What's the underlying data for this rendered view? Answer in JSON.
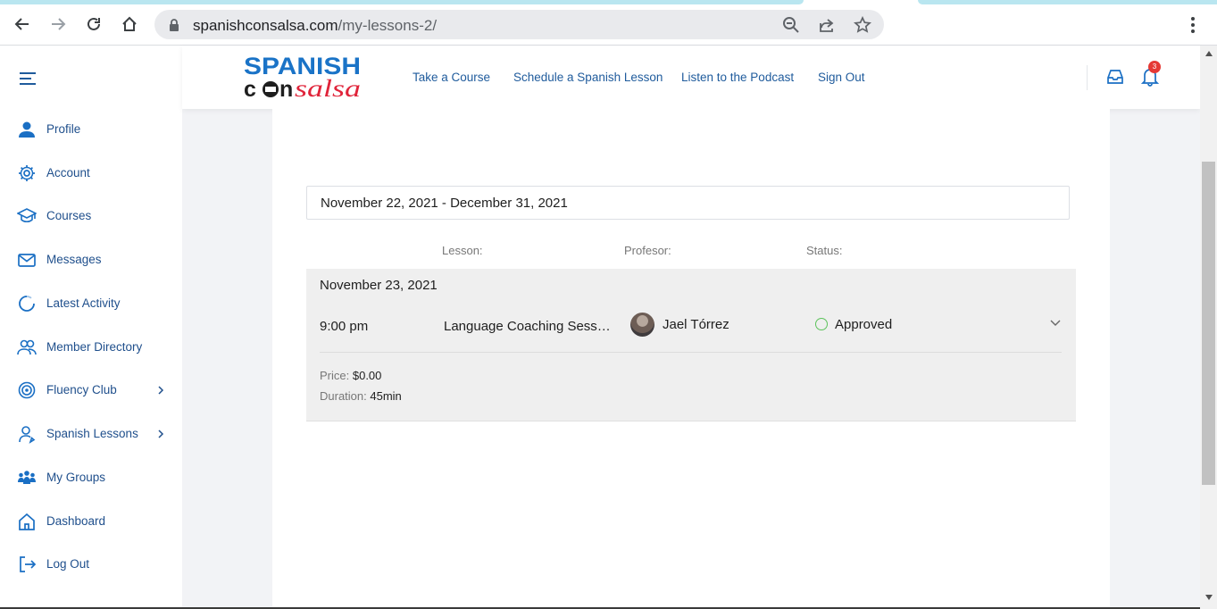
{
  "browser": {
    "url_host": "spanishconsalsa.com",
    "url_path": "/my-lessons-2/"
  },
  "site": {
    "logo_line1": "SPANISH",
    "logo_line2_a": "c",
    "logo_line2_b": "n",
    "logo_line2_c": "salsa",
    "nav": [
      "Take a Course",
      "Schedule a Spanish Lesson",
      "Listen to the Podcast",
      "Sign Out"
    ],
    "notification_count": "3"
  },
  "sidebar": {
    "items": [
      {
        "label": "Profile",
        "icon": "user-icon"
      },
      {
        "label": "Account",
        "icon": "gear-icon"
      },
      {
        "label": "Courses",
        "icon": "graduation-cap-icon"
      },
      {
        "label": "Messages",
        "icon": "envelope-icon"
      },
      {
        "label": "Latest Activity",
        "icon": "activity-icon"
      },
      {
        "label": "Member Directory",
        "icon": "users-icon"
      },
      {
        "label": "Fluency Club",
        "icon": "target-icon"
      },
      {
        "label": "Spanish Lessons",
        "icon": "person-outline-icon"
      },
      {
        "label": "My Groups",
        "icon": "groups-icon"
      },
      {
        "label": "Dashboard",
        "icon": "home-icon"
      },
      {
        "label": "Log Out",
        "icon": "logout-icon"
      }
    ]
  },
  "lessons": {
    "date_range": "November 22, 2021 - December 31, 2021",
    "col_lesson": "Lesson:",
    "col_profesor": "Profesor:",
    "col_status": "Status:",
    "entry": {
      "date": "November 23, 2021",
      "time": "9:00 pm",
      "lesson": "Language Coaching Session",
      "profesor": "Jael Tórrez",
      "status": "Approved",
      "price_label": "Price:",
      "price_value": "$0.00",
      "duration_label": "Duration:",
      "duration_value": "45min"
    }
  },
  "colors": {
    "accent": "#1f5b9c",
    "status_approved": "#5cc35b",
    "badge": "#e53935",
    "logo_blue": "#1a73c7",
    "logo_red": "#e0243a"
  }
}
